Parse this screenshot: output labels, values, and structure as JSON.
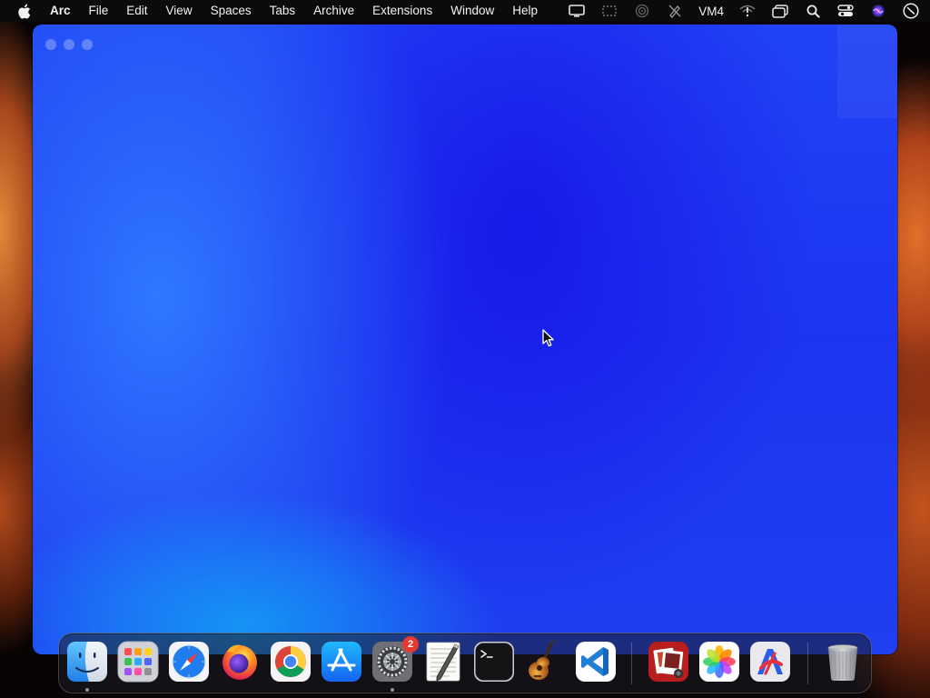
{
  "menubar": {
    "app_name": "Arc",
    "items": [
      "File",
      "Edit",
      "View",
      "Spaces",
      "Tabs",
      "Archive",
      "Extensions",
      "Window",
      "Help"
    ],
    "status_label": "VM4"
  },
  "dock": {
    "settings_badge": "2"
  },
  "colors": {
    "window_blue": "#1f3ff0",
    "badge_red": "#e5392f"
  }
}
